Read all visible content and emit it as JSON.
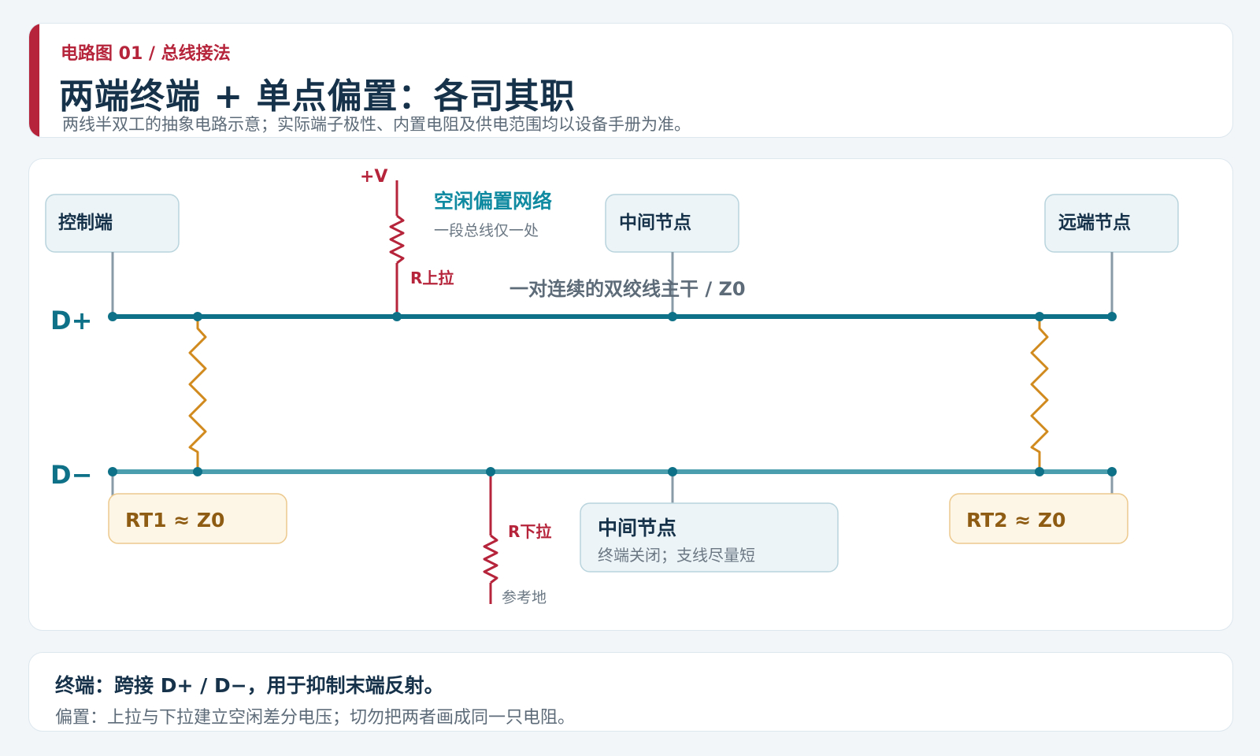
{
  "header": {
    "kicker": "电路图 01 / 总线接法",
    "title": "两端终端 + 单点偏置：各司其职",
    "subtitle": "两线半双工的抽象电路示意；实际端子极性、内置电阻及供电范围均以设备手册为准。"
  },
  "diagram": {
    "lines": {
      "d_plus": "D+",
      "d_minus": "D−"
    },
    "trunk_label": "一对连续的双绞线主干 / Z0",
    "nodes": {
      "controller": "控制端",
      "middle_top": "中间节点",
      "far_end": "远端节点",
      "middle_bottom": {
        "title": "中间节点",
        "subtitle": "终端关闭；支线尽量短"
      }
    },
    "bias": {
      "supply": "+V",
      "title": "空闲偏置网络",
      "subtitle": "一段总线仅一处",
      "pull_up": "R上拉",
      "pull_down": "R下拉",
      "ground": "参考地"
    },
    "terminations": {
      "rt1": "RT1 ≈ Z0",
      "rt2": "RT2 ≈ Z0"
    },
    "colors": {
      "d_plus": "#0f7187",
      "d_minus": "#4a9ead",
      "bias_resistor": "#b5243a",
      "termination_resistor": "#d08a1e",
      "node_stub": "#8a9ba8"
    }
  },
  "note": {
    "line1": "终端：跨接 D+ / D−，用于抑制末端反射。",
    "line2": "偏置：上拉与下拉建立空闲差分电压；切勿把两者画成同一只电阻。"
  }
}
